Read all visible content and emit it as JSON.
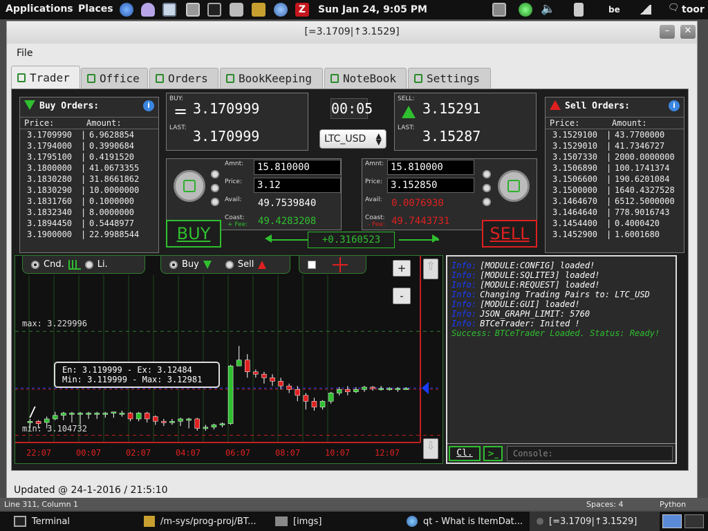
{
  "topbar": {
    "applications": "Applications",
    "places": "Places",
    "datetime": "Sun Jan 24,  9:05 PM",
    "keyboard": "be",
    "user": "toor",
    "icons": [
      "globe-icon",
      "ghost-icon",
      "monitor-icon",
      "calculator-icon",
      "terminal-icon",
      "camera-icon",
      "editor-icon",
      "network-icon",
      "filezilla-icon"
    ]
  },
  "window": {
    "title": "[=3.1709|↑3.1529]",
    "min": "–",
    "close": "✕"
  },
  "menu": {
    "file": "File"
  },
  "tabs": [
    {
      "label": "Trader",
      "active": true
    },
    {
      "label": "Office"
    },
    {
      "label": "Orders"
    },
    {
      "label": "BookKeeping"
    },
    {
      "label": "NoteBook"
    },
    {
      "label": "Settings"
    }
  ],
  "buy_orders": {
    "title": "Buy Orders:",
    "col_price": "Price:",
    "col_amount": "Amount:",
    "rows": [
      {
        "price": "3.1709990",
        "amount": "6.9628854"
      },
      {
        "price": "3.1794000",
        "amount": "0.3990684"
      },
      {
        "price": "3.1795100",
        "amount": "0.4191520"
      },
      {
        "price": "3.1800000",
        "amount": "41.0673355"
      },
      {
        "price": "3.1830280",
        "amount": "31.8661862"
      },
      {
        "price": "3.1830290",
        "amount": "10.0000000"
      },
      {
        "price": "3.1831760",
        "amount": "0.1000000"
      },
      {
        "price": "3.1832340",
        "amount": "8.0000000"
      },
      {
        "price": "3.1894450",
        "amount": "0.5448977"
      },
      {
        "price": "3.1900000",
        "amount": "22.9988544"
      }
    ]
  },
  "sell_orders": {
    "title": "Sell Orders:",
    "col_price": "Price:",
    "col_amount": "Amount:",
    "rows": [
      {
        "price": "3.1529100",
        "amount": "43.7700000"
      },
      {
        "price": "3.1529010",
        "amount": "41.7346727"
      },
      {
        "price": "3.1507330",
        "amount": "2000.0000000"
      },
      {
        "price": "3.1506890",
        "amount": "100.1741374"
      },
      {
        "price": "3.1506600",
        "amount": "190.6201084"
      },
      {
        "price": "3.1500000",
        "amount": "1640.4327528"
      },
      {
        "price": "3.1464670",
        "amount": "6512.5000000"
      },
      {
        "price": "3.1464640",
        "amount": "778.9016743"
      },
      {
        "price": "3.1454400",
        "amount": "0.4000420"
      },
      {
        "price": "3.1452900",
        "amount": "1.6001680"
      }
    ]
  },
  "ticker": {
    "buy_label": "BUY:",
    "buy_value": "3.170999",
    "buy_last_label": "LAST:",
    "buy_last_value": "3.170999",
    "sell_label": "SELL:",
    "sell_value": "3.15291",
    "sell_last_label": "LAST:",
    "sell_last_value": "3.15287",
    "timer": "00:05",
    "pair": "LTC_USD"
  },
  "buy_form": {
    "amnt_label": "Amnt:",
    "amnt": "15.810000",
    "price_label": "Price:",
    "price": "3.12",
    "avail_label": "Avail:",
    "avail": "49.7539840",
    "coast_label": "Coast:",
    "fee_label": "+ Fee:",
    "coast": "49.4283208",
    "button": "BUY"
  },
  "sell_form": {
    "amnt_label": "Amnt:",
    "amnt": "15.810000",
    "price_label": "Price:",
    "price": "3.152850",
    "avail_label": "Avail:",
    "avail": "0.0076930",
    "coast_label": "Coast:",
    "fee_label": "- Fee:",
    "coast": "49.7443731",
    "button": "SELL"
  },
  "spread": "+0.3160523",
  "chart_controls": {
    "candle": "Cnd.",
    "line": "Li.",
    "buy": "Buy",
    "sell": "Sell",
    "zoom_in": "+",
    "zoom_out": "-"
  },
  "chart_data": {
    "type": "candlestick",
    "max_label": "max: 3.229996",
    "min_label": "min: 3.104732",
    "ylim": [
      3.1,
      3.235
    ],
    "x_ticks": [
      "22:07",
      "00:07",
      "02:07",
      "04:07",
      "06:07",
      "08:07",
      "10:07",
      "12:07"
    ],
    "tooltip_line1": "En: 3.119999 - Ex: 3.12484",
    "tooltip_line2": "Min: 3.119999 - Max: 3.12981",
    "candles": [
      [
        3.118,
        3.118,
        3.112,
        3.12
      ],
      [
        3.118,
        3.116,
        3.112,
        3.119
      ],
      [
        3.117,
        3.12,
        3.112,
        3.122
      ],
      [
        3.12,
        3.123,
        3.119,
        3.126
      ],
      [
        3.123,
        3.125,
        3.119,
        3.126
      ],
      [
        3.125,
        3.125,
        3.117,
        3.126
      ],
      [
        3.125,
        3.125,
        3.115,
        3.126
      ],
      [
        3.125,
        3.125,
        3.12,
        3.126
      ],
      [
        3.125,
        3.125,
        3.12,
        3.126
      ],
      [
        3.125,
        3.125,
        3.121,
        3.126
      ],
      [
        3.125,
        3.126,
        3.121,
        3.126
      ],
      [
        3.125,
        3.125,
        3.122,
        3.127
      ],
      [
        3.125,
        3.12,
        3.118,
        3.126
      ],
      [
        3.12,
        3.125,
        3.118,
        3.126
      ],
      [
        3.125,
        3.12,
        3.117,
        3.126
      ],
      [
        3.122,
        3.118,
        3.115,
        3.123
      ],
      [
        3.118,
        3.117,
        3.114,
        3.12
      ],
      [
        3.117,
        3.118,
        3.115,
        3.12
      ],
      [
        3.118,
        3.12,
        3.114,
        3.121
      ],
      [
        3.12,
        3.12,
        3.112,
        3.121
      ],
      [
        3.12,
        3.112,
        3.11,
        3.121
      ],
      [
        3.112,
        3.113,
        3.11,
        3.115
      ],
      [
        3.113,
        3.115,
        3.111,
        3.116
      ],
      [
        3.115,
        3.116,
        3.113,
        3.117
      ],
      [
        3.116,
        3.165,
        3.115,
        3.166
      ],
      [
        3.165,
        3.17,
        3.165,
        3.182
      ],
      [
        3.17,
        3.16,
        3.155,
        3.175
      ],
      [
        3.16,
        3.158,
        3.155,
        3.162
      ],
      [
        3.158,
        3.155,
        3.15,
        3.16
      ],
      [
        3.155,
        3.152,
        3.148,
        3.158
      ],
      [
        3.152,
        3.148,
        3.145,
        3.155
      ],
      [
        3.148,
        3.145,
        3.142,
        3.15
      ],
      [
        3.145,
        3.14,
        3.135,
        3.148
      ],
      [
        3.14,
        3.135,
        3.128,
        3.142
      ],
      [
        3.135,
        3.13,
        3.127,
        3.138
      ],
      [
        3.13,
        3.135,
        3.128,
        3.136
      ],
      [
        3.135,
        3.142,
        3.133,
        3.143
      ],
      [
        3.142,
        3.145,
        3.14,
        3.147
      ],
      [
        3.145,
        3.143,
        3.14,
        3.148
      ],
      [
        3.143,
        3.145,
        3.142,
        3.147
      ],
      [
        3.145,
        3.147,
        3.143,
        3.148
      ],
      [
        3.147,
        3.146,
        3.144,
        3.148
      ],
      [
        3.146,
        3.146,
        3.144,
        3.148
      ],
      [
        3.146,
        3.146,
        3.144,
        3.147
      ],
      [
        3.146,
        3.146,
        3.143,
        3.147
      ],
      [
        3.146,
        3.146,
        3.145,
        3.147
      ]
    ],
    "buy_line": 3.1462,
    "sell_line": 3.1452,
    "green_ref_line": 3.165,
    "red_ref_line": 3.112
  },
  "console": {
    "logs": [
      {
        "tag": "Info:",
        "text": "[MODULE:CONFIG] loaded!"
      },
      {
        "tag": "Info:",
        "text": "[MODULE:SQLITE3] loaded!"
      },
      {
        "tag": "Info:",
        "text": "[MODULE:REQUEST] loaded!"
      },
      {
        "tag": "Info:",
        "text": "Changing Trading Pairs to: LTC_USD"
      },
      {
        "tag": "Info:",
        "text": "[MODULE:GUI] loaded!"
      },
      {
        "tag": "Info:",
        "text": "JSON_GRAPH_LIMIT: 5760"
      },
      {
        "tag": "Info:",
        "text": "BTCeTrader: Inited !"
      },
      {
        "tag": "Success:",
        "text": "BTCeTrader Loaded. Status: Ready!"
      }
    ],
    "clear_button": "Cl.",
    "input_placeholder": "Console:"
  },
  "statusbar": {
    "updated": "Updated @ 24-1-2016 / 21:5:10"
  },
  "editor_status": {
    "position": "Line 311, Column 1",
    "spaces": "Spaces: 4",
    "language": "Python"
  },
  "taskbar": {
    "items": [
      {
        "label": "Terminal"
      },
      {
        "label": "/m-sys/prog-proj/BT..."
      },
      {
        "label": "[imgs]"
      },
      {
        "label": "qt - What is ItemDat..."
      },
      {
        "label": "[=3.1709|↑3.1529]"
      }
    ]
  },
  "colors": {
    "green": "#2fbf2f",
    "red": "#e02020",
    "blue": "#1a3cff",
    "panel": "#1d1d1d"
  }
}
